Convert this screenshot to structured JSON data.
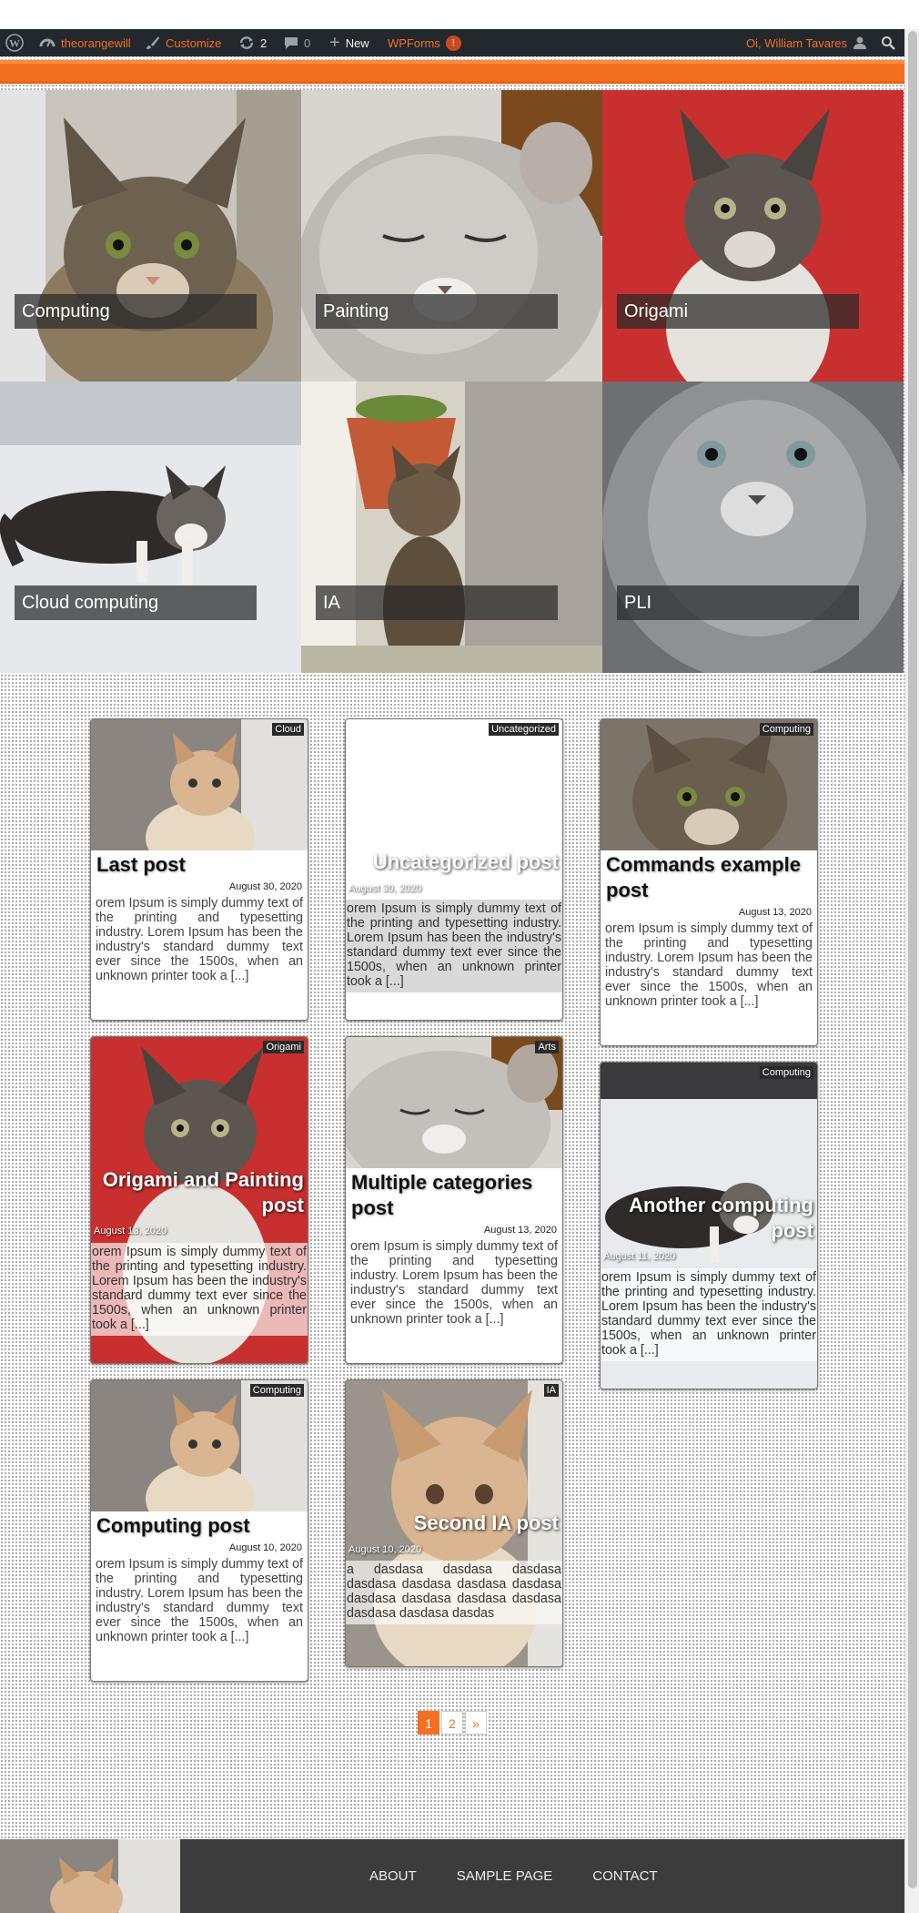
{
  "adminbar": {
    "site_name": "theorangewill",
    "customize": "Customize",
    "updates_count": "2",
    "comments_count": "0",
    "new_label": "New",
    "wpforms_label": "WPForms",
    "wpforms_badge": "!",
    "greeting": "Oi, William Tavares"
  },
  "hero": {
    "tiles": [
      {
        "label": "Computing"
      },
      {
        "label": "Painting"
      },
      {
        "label": "Origami"
      },
      {
        "label": "Cloud computing"
      },
      {
        "label": "IA"
      },
      {
        "label": "PLI"
      }
    ]
  },
  "posts": [
    {
      "category": "Cloud",
      "title": "Last post",
      "date": "August 30, 2020",
      "excerpt": "orem Ipsum is simply dummy text of the printing and typesetting industry. Lorem Ipsum has been the industry's standard dummy text ever since the 1500s, when an unknown printer took a [...]"
    },
    {
      "category": "Uncategorized",
      "title": "Uncategorized post",
      "date": "August 30, 2020",
      "excerpt": "orem Ipsum is simply dummy text of the printing and typesetting industry. Lorem Ipsum has been the industry's standard dummy text ever since the 1500s, when an unknown printer took a [...]"
    },
    {
      "category": "Computing",
      "title": "Commands example post",
      "date": "August 13, 2020",
      "excerpt": "orem Ipsum is simply dummy text of the printing and typesetting industry. Lorem Ipsum has been the industry's standard dummy text ever since the 1500s, when an unknown printer took a [...]"
    },
    {
      "category": "Origami",
      "title": "Origami and Painting post",
      "date": "August 13, 2020",
      "excerpt": "orem Ipsum is simply dummy text of the printing and typesetting industry. Lorem Ipsum has been the industry's standard dummy text ever since the 1500s, when an unknown printer took a [...]"
    },
    {
      "category": "Arts",
      "title": "Multiple categories post",
      "date": "August 13, 2020",
      "excerpt": "orem Ipsum is simply dummy text of the printing and typesetting industry. Lorem Ipsum has been the industry's standard dummy text ever since the 1500s, when an unknown printer took a [...]"
    },
    {
      "category": "Computing",
      "title": "Another computing post",
      "date": "August 11, 2020",
      "excerpt": "orem Ipsum is simply dummy text of the printing and typesetting industry. Lorem Ipsum has been the industry's standard dummy text ever since the 1500s, when an unknown printer took a [...]"
    },
    {
      "category": "Computing",
      "title": "Computing post",
      "date": "August 10, 2020",
      "excerpt": "orem Ipsum is simply dummy text of the printing and typesetting industry. Lorem Ipsum has been the industry's standard dummy text ever since the 1500s, when an unknown printer took a [...]"
    },
    {
      "category": "IA",
      "title": "Second IA post",
      "date": "August 10, 2020",
      "excerpt": "a dasdasa dasdasa dasdasa dasdasa dasdasa dasdasa dasdasa dasdasa dasdasa dasdasa dasdasa dasdasa dasdasa dasdas"
    }
  ],
  "pagination": {
    "page1": "1",
    "page2": "2",
    "next": "»"
  },
  "footer": {
    "about": "ABOUT",
    "sample_page": "SAMPLE PAGE",
    "contact": "CONTACT"
  },
  "colors": {
    "accent": "#f37021",
    "adminbar": "#23282d",
    "footer": "#3c3c3c"
  }
}
